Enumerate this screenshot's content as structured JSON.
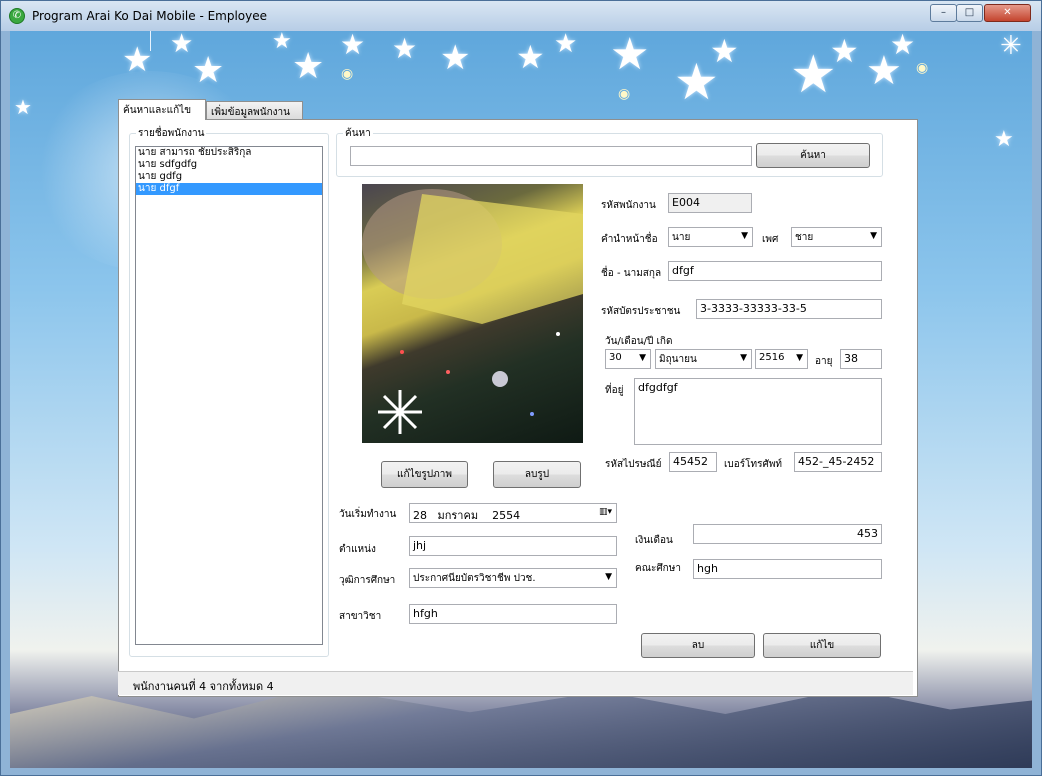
{
  "window": {
    "title": "Program Arai Ko Dai Mobile - Employee",
    "controls": {
      "minimize": "–",
      "maximize": "□",
      "close": "✕"
    }
  },
  "tabs": [
    {
      "label": "ค้นหาและแก้ไข",
      "active": true
    },
    {
      "label": "เพิ่มข้อมูลพนักงาน",
      "active": false
    }
  ],
  "employee_list": {
    "group_label": "รายชื่อพนักงาน",
    "items": [
      {
        "label": "นาย สามารถ ชัยประสิริกุล",
        "selected": false
      },
      {
        "label": "นาย sdfgdfg",
        "selected": false
      },
      {
        "label": "นาย gdfg",
        "selected": false
      },
      {
        "label": "นาย dfgf",
        "selected": true
      }
    ]
  },
  "search": {
    "group_label": "ค้นหา",
    "input_value": "",
    "button_label": "ค้นหา"
  },
  "photo_buttons": {
    "edit": "แก้ไขรูปภาพ",
    "delete": "ลบรูป"
  },
  "form": {
    "employee_id_label": "รหัสพนักงาน",
    "employee_id": "E004",
    "prefix_label": "คำนำหน้าชื่อ",
    "prefix": "นาย",
    "gender_label": "เพศ",
    "gender": "ชาย",
    "fullname_label": "ชื่อ - นามสกุล",
    "fullname": "dfgf",
    "citizen_id_label": "รหัสบัตรประชาชน",
    "citizen_id": "3-3333-33333-33-5",
    "birthdate_label": "วัน/เดือน/ปี เกิด",
    "birth_day": "30",
    "birth_month": "มิถุนายน",
    "birth_year": "2516",
    "age_label": "อายุ",
    "age": "38",
    "address_label": "ที่อยู่",
    "address": "dfgdfgf",
    "postcode_label": "รหัสไปรษณีย์",
    "postcode": "45452",
    "phone_label": "เบอร์โทรศัพท์",
    "phone": "452-_45-2452",
    "start_date_label": "วันเริ่มทำงาน",
    "start_date": "28   มกราคม    2554",
    "position_label": "ตำแหน่ง",
    "position": "jhj",
    "education_label": "วุฒิการศึกษา",
    "education": "ประกาศนียบัตรวิชาชีพ ปวช.",
    "major_label": "สาขาวิชา",
    "major": "hfgh",
    "salary_label": "เงินเดือน",
    "salary": "453",
    "faculty_label": "คณะศึกษา",
    "faculty": "hgh"
  },
  "actions": {
    "delete": "ลบ",
    "edit": "แก้ไข"
  },
  "status": {
    "text": "พนักงานคนที่ 4 จากทั้งหมด 4"
  }
}
